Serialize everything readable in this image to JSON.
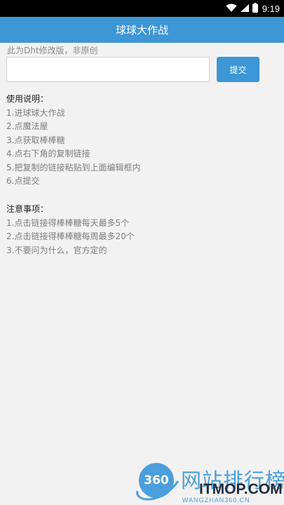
{
  "status_bar": {
    "time": "9:19",
    "icons": [
      "wifi-icon",
      "signal-icon",
      "battery-icon"
    ]
  },
  "app_bar": {
    "title": "球球大作战"
  },
  "form": {
    "note": "此为Dht修改版，非原创",
    "input_value": "",
    "submit_label": "提交"
  },
  "usage": {
    "heading": "使用说明：",
    "items": [
      "1.进球球大作战",
      "2.点魔法屋",
      "3.点获取棒棒糖",
      "4.点右下角的复制链接",
      "5.把复制的链接粘贴到上面编辑框内",
      "6.点提交"
    ]
  },
  "notes": {
    "heading": "注意事项：",
    "items": [
      "1.点击链接得棒棒糖每天最多5个",
      "2.点击链接得棒棒糖每周最多20个",
      "3.不要问为什么，官方定的"
    ]
  },
  "watermark": {
    "logo_number": "360",
    "cn_text": "网站排行榜",
    "brand": "ITMOP.COM",
    "url": "WANGZHAN360.CN"
  },
  "colors": {
    "accent": "#3d96d6",
    "background": "#f2f2f2",
    "muted_text": "#7e7e7e"
  }
}
